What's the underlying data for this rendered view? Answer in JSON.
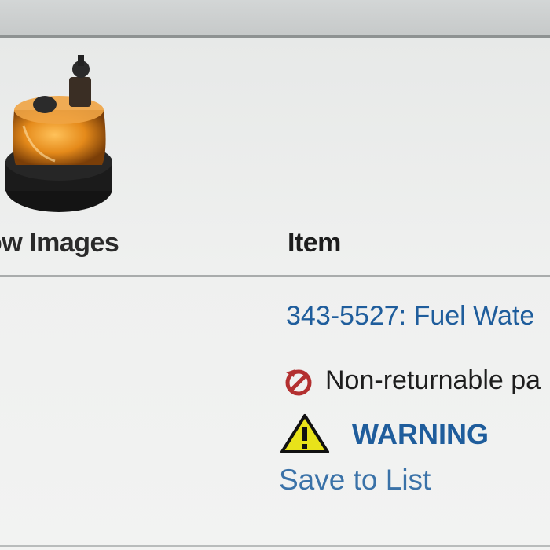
{
  "table": {
    "headers": {
      "images": "ow Images",
      "item": "Item"
    },
    "rows": [
      {
        "item_link": "343-5527: Fuel Wate",
        "notice": "Non-returnable pa",
        "warning": "WARNING",
        "save": "Save to List"
      }
    ]
  },
  "icons": {
    "thumbnail": "fuel-water-separator-image",
    "non_returnable": "no-return-icon",
    "warning": "warning-triangle-icon"
  },
  "colors": {
    "link": "#1f5d9c",
    "warning_fill": "#e8e21a",
    "no_return": "#b33030"
  }
}
